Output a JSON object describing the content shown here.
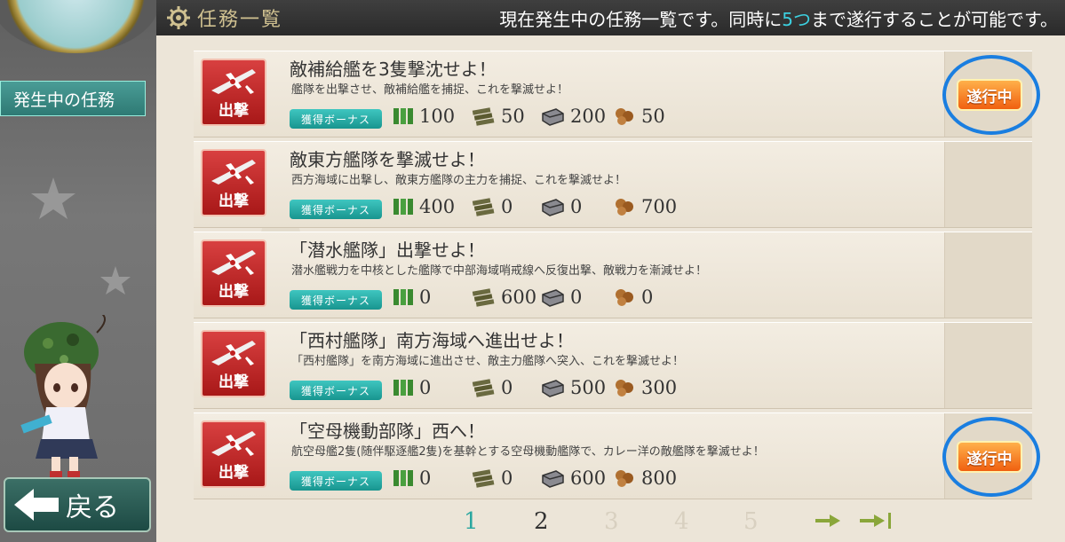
{
  "header": {
    "title": "任務一覧",
    "info_pre": "現在発生中の任務一覧です。同時に",
    "info_num": "5つ",
    "info_post": "まで遂行することが可能です。"
  },
  "sidebar": {
    "active_item": "発生中の任務",
    "back_label": "戻る"
  },
  "quests": [
    {
      "icon_label": "出撃",
      "title": "敵補給艦を3隻撃沈せよ！",
      "desc": "艦隊を出撃させ、敵補給艦を捕捉、これを撃滅せよ！",
      "bonus": "獲得ボーナス",
      "fuel": "100",
      "ammo": "50",
      "steel": "200",
      "bauxite": "50",
      "status": "遂行中"
    },
    {
      "icon_label": "出撃",
      "title": "敵東方艦隊を撃滅せよ！",
      "desc": "西方海域に出撃し、敵東方艦隊の主力を捕捉、これを撃滅せよ！",
      "bonus": "獲得ボーナス",
      "fuel": "400",
      "ammo": "0",
      "steel": "0",
      "bauxite": "700",
      "status": ""
    },
    {
      "icon_label": "出撃",
      "title": "「潜水艦隊」出撃せよ！",
      "desc": "潜水艦戦力を中核とした艦隊で中部海域哨戒線へ反復出撃、敵戦力を漸減せよ！",
      "bonus": "獲得ボーナス",
      "fuel": "0",
      "ammo": "600",
      "steel": "0",
      "bauxite": "0",
      "status": ""
    },
    {
      "icon_label": "出撃",
      "title": "「西村艦隊」南方海域へ進出せよ！",
      "desc": "「西村艦隊」を南方海域に進出させ、敵主力艦隊へ突入、これを撃滅せよ！",
      "bonus": "獲得ボーナス",
      "fuel": "0",
      "ammo": "0",
      "steel": "500",
      "bauxite": "300",
      "status": ""
    },
    {
      "icon_label": "出撃",
      "title": "「空母機動部隊」西へ！",
      "desc": "航空母艦2隻(随伴駆逐艦2隻)を基幹とする空母機動艦隊で、カレー洋の敵艦隊を撃滅せよ！",
      "bonus": "獲得ボーナス",
      "fuel": "0",
      "ammo": "0",
      "steel": "600",
      "bauxite": "800",
      "status": "遂行中"
    }
  ],
  "pagination": {
    "pages": [
      "1",
      "2",
      "3",
      "4",
      "5"
    ],
    "current": "1"
  },
  "colors": {
    "active_page": "#2aa7a0",
    "enabled_page": "#333333",
    "disabled_page": "#d8d0c0",
    "highlight_ring": "#1a7ee0"
  }
}
